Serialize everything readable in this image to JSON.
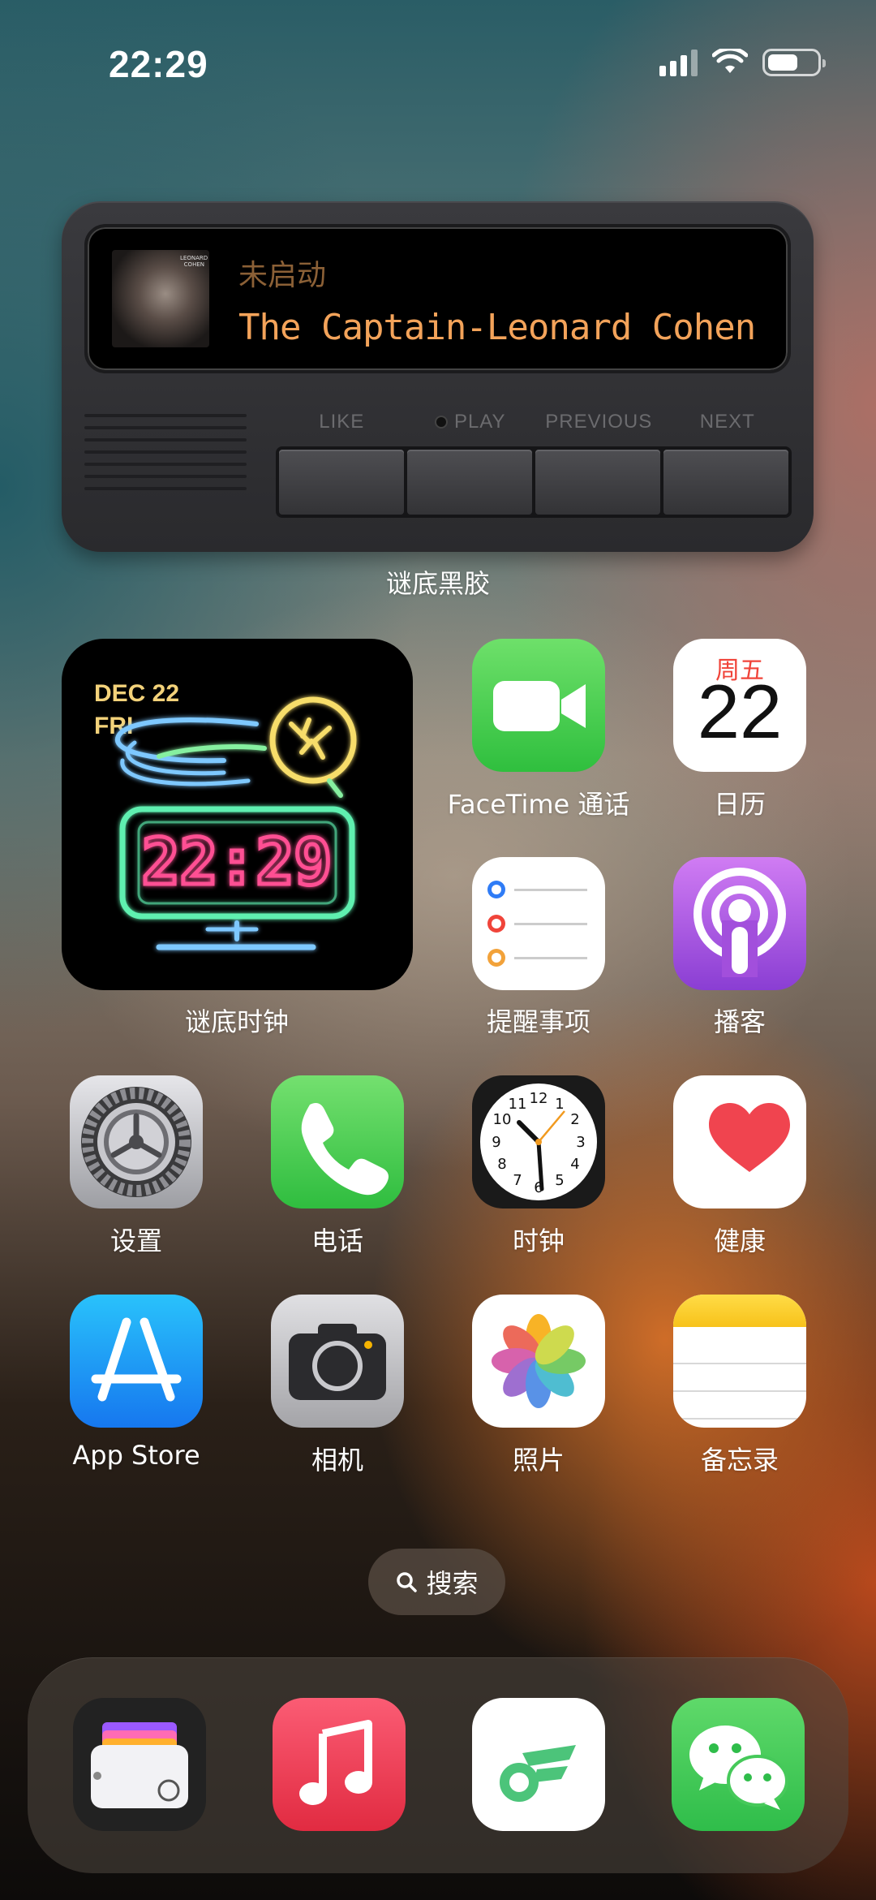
{
  "status_bar": {
    "time": "22:29",
    "battery_level": 0.62
  },
  "music_widget": {
    "status": "未启动",
    "track": "The Captain-Leonard Cohen",
    "album_art_text": "LEONARD COHEN",
    "buttons": [
      "LIKE",
      "PLAY",
      "PREVIOUS",
      "NEXT"
    ],
    "label": "谜底黑胶"
  },
  "clock_widget": {
    "date": "DEC 22",
    "day": "FRI",
    "time": "22:29",
    "label": "谜底时钟"
  },
  "calendar": {
    "weekday": "周五",
    "date": "22"
  },
  "apps": {
    "facetime": "FaceTime 通话",
    "calendar": "日历",
    "reminders": "提醒事项",
    "podcasts": "播客",
    "settings": "设置",
    "phone": "电话",
    "clock": "时钟",
    "health": "健康",
    "appstore": "App Store",
    "camera": "相机",
    "photos": "照片",
    "notes": "备忘录"
  },
  "search": {
    "label": "搜索"
  },
  "colors": {
    "screen_text": "#f3a35a",
    "clock_neon_time": "#ff4f93",
    "clock_neon_frame": "#5ef0b0",
    "accent_red": "#f0443a"
  }
}
